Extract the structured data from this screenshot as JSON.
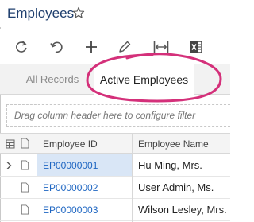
{
  "window": {
    "title": "Employees"
  },
  "toolbar": {
    "buttons": [
      {
        "name": "refresh",
        "icon": "refresh-icon"
      },
      {
        "name": "undo",
        "icon": "undo-icon"
      },
      {
        "name": "add",
        "icon": "plus-icon"
      },
      {
        "name": "edit",
        "icon": "pencil-icon"
      },
      {
        "name": "fit-columns",
        "icon": "fit-columns-icon"
      },
      {
        "name": "export-excel",
        "icon": "excel-icon"
      }
    ]
  },
  "tabs": [
    {
      "label": "All Records",
      "active": false
    },
    {
      "label": "Active Employees",
      "active": true
    }
  ],
  "filter": {
    "placeholder": "Drag column header here to configure filter"
  },
  "grid": {
    "columns": [
      "Employee ID",
      "Employee Name"
    ],
    "rows": [
      {
        "id": "EP00000001",
        "name": "Hu Ming, Mrs.",
        "selected": true
      },
      {
        "id": "EP00000002",
        "name": "User Admin, Ms.",
        "selected": false
      },
      {
        "id": "EP00000003",
        "name": "Wilson Lesley, Mrs.",
        "selected": false
      }
    ]
  },
  "colors": {
    "title": "#1f3f6e",
    "link": "#1e66c2",
    "highlight_ellipse": "#d4307a",
    "selected_row": "#d9e6f6"
  }
}
